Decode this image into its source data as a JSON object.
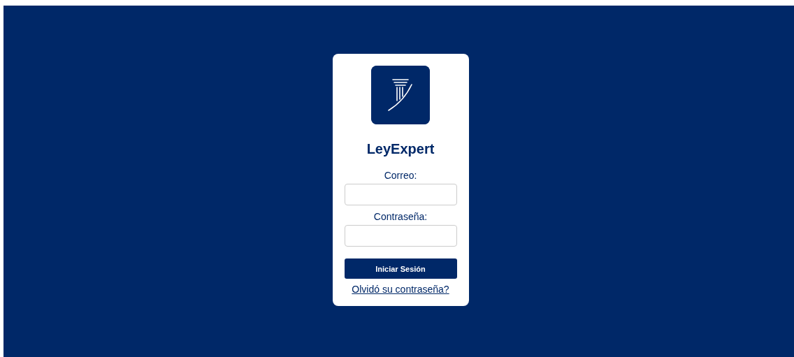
{
  "app": {
    "title": "LeyExpert"
  },
  "fields": [
    {
      "label": "Correo:"
    },
    {
      "label": "Contraseña:"
    }
  ],
  "submit": {
    "label": "Iniciar Sesión"
  },
  "forgot_link": {
    "label": "Olvidó su contraseña?"
  }
}
